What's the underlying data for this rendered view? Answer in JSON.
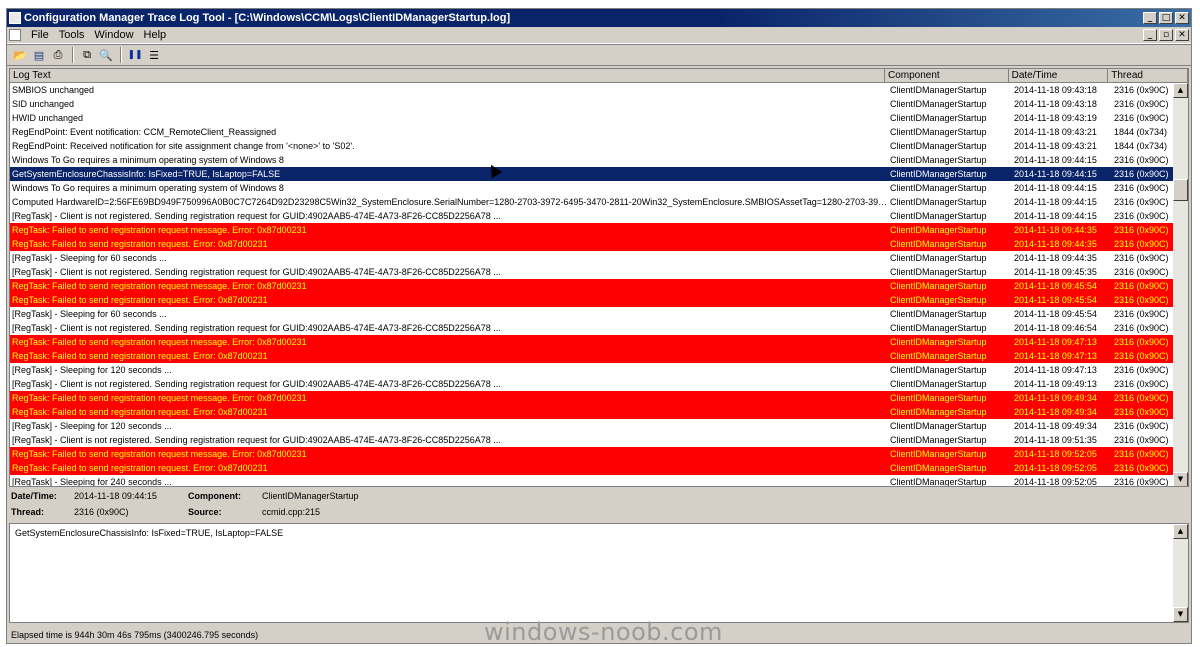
{
  "window": {
    "title": "Configuration Manager Trace Log Tool - [C:\\Windows\\CCM\\Logs\\ClientIDManagerStartup.log]",
    "minimize": "_",
    "maximize": "□",
    "close": "✕",
    "child_minimize": "_",
    "child_restore": "▫",
    "child_close": "✕"
  },
  "menu": {
    "file": "File",
    "tools": "Tools",
    "window": "Window",
    "help": "Help"
  },
  "toolbar": {
    "open": "📂",
    "save": "▤",
    "print": "⎙",
    "copy": "⧉",
    "find": "🔍",
    "pause": "❚❚",
    "view": "☰"
  },
  "columns": {
    "log_text": "Log Text",
    "component": "Component",
    "datetime": "Date/Time",
    "thread": "Thread"
  },
  "rows": [
    {
      "text": "SMBIOS unchanged",
      "component": "ClientIDManagerStartup",
      "datetime": "2014-11-18 09:43:18",
      "thread": "2316 (0x90C)",
      "type": "normal"
    },
    {
      "text": "SID unchanged",
      "component": "ClientIDManagerStartup",
      "datetime": "2014-11-18 09:43:18",
      "thread": "2316 (0x90C)",
      "type": "normal"
    },
    {
      "text": "HWID unchanged",
      "component": "ClientIDManagerStartup",
      "datetime": "2014-11-18 09:43:19",
      "thread": "2316 (0x90C)",
      "type": "normal"
    },
    {
      "text": "RegEndPoint: Event notification: CCM_RemoteClient_Reassigned",
      "component": "ClientIDManagerStartup",
      "datetime": "2014-11-18 09:43:21",
      "thread": "1844 (0x734)",
      "type": "normal"
    },
    {
      "text": "RegEndPoint: Received notification for site assignment change from '<none>' to 'S02'.",
      "component": "ClientIDManagerStartup",
      "datetime": "2014-11-18 09:43:21",
      "thread": "1844 (0x734)",
      "type": "normal"
    },
    {
      "text": "Windows To Go requires a minimum operating system of Windows 8",
      "component": "ClientIDManagerStartup",
      "datetime": "2014-11-18 09:44:15",
      "thread": "2316 (0x90C)",
      "type": "normal"
    },
    {
      "text": "GetSystemEnclosureChassisInfo: IsFixed=TRUE, IsLaptop=FALSE",
      "component": "ClientIDManagerStartup",
      "datetime": "2014-11-18 09:44:15",
      "thread": "2316 (0x90C)",
      "type": "selected"
    },
    {
      "text": "Windows To Go requires a minimum operating system of Windows 8",
      "component": "ClientIDManagerStartup",
      "datetime": "2014-11-18 09:44:15",
      "thread": "2316 (0x90C)",
      "type": "normal"
    },
    {
      "text": "Computed HardwareID=2:56FE69BD949F750996A0B0C7C7264D92D23298C5Win32_SystemEnclosure.SerialNumber=1280-2703-3972-6495-3470-2811-20Win32_SystemEnclosure.SMBIOSAssetTag=1280-2703-3972-...",
      "component": "ClientIDManagerStartup",
      "datetime": "2014-11-18 09:44:15",
      "thread": "2316 (0x90C)",
      "type": "normal"
    },
    {
      "text": "[RegTask] - Client is not registered. Sending registration request for GUID:4902AAB5-474E-4A73-8F26-CC85D2256A78 ...",
      "component": "ClientIDManagerStartup",
      "datetime": "2014-11-18 09:44:15",
      "thread": "2316 (0x90C)",
      "type": "normal"
    },
    {
      "text": "RegTask: Failed to send registration request message. Error: 0x87d00231",
      "component": "ClientIDManagerStartup",
      "datetime": "2014-11-18 09:44:35",
      "thread": "2316 (0x90C)",
      "type": "error"
    },
    {
      "text": "RegTask: Failed to send registration request. Error: 0x87d00231",
      "component": "ClientIDManagerStartup",
      "datetime": "2014-11-18 09:44:35",
      "thread": "2316 (0x90C)",
      "type": "error"
    },
    {
      "text": "[RegTask] - Sleeping for 60 seconds ...",
      "component": "ClientIDManagerStartup",
      "datetime": "2014-11-18 09:44:35",
      "thread": "2316 (0x90C)",
      "type": "normal"
    },
    {
      "text": "[RegTask] - Client is not registered. Sending registration request for GUID:4902AAB5-474E-4A73-8F26-CC85D2256A78 ...",
      "component": "ClientIDManagerStartup",
      "datetime": "2014-11-18 09:45:35",
      "thread": "2316 (0x90C)",
      "type": "normal"
    },
    {
      "text": "RegTask: Failed to send registration request message. Error: 0x87d00231",
      "component": "ClientIDManagerStartup",
      "datetime": "2014-11-18 09:45:54",
      "thread": "2316 (0x90C)",
      "type": "error"
    },
    {
      "text": "RegTask: Failed to send registration request. Error: 0x87d00231",
      "component": "ClientIDManagerStartup",
      "datetime": "2014-11-18 09:45:54",
      "thread": "2316 (0x90C)",
      "type": "error"
    },
    {
      "text": "[RegTask] - Sleeping for 60 seconds ...",
      "component": "ClientIDManagerStartup",
      "datetime": "2014-11-18 09:45:54",
      "thread": "2316 (0x90C)",
      "type": "normal"
    },
    {
      "text": "[RegTask] - Client is not registered. Sending registration request for GUID:4902AAB5-474E-4A73-8F26-CC85D2256A78 ...",
      "component": "ClientIDManagerStartup",
      "datetime": "2014-11-18 09:46:54",
      "thread": "2316 (0x90C)",
      "type": "normal"
    },
    {
      "text": "RegTask: Failed to send registration request message. Error: 0x87d00231",
      "component": "ClientIDManagerStartup",
      "datetime": "2014-11-18 09:47:13",
      "thread": "2316 (0x90C)",
      "type": "error"
    },
    {
      "text": "RegTask: Failed to send registration request. Error: 0x87d00231",
      "component": "ClientIDManagerStartup",
      "datetime": "2014-11-18 09:47:13",
      "thread": "2316 (0x90C)",
      "type": "error"
    },
    {
      "text": "[RegTask] - Sleeping for 120 seconds ...",
      "component": "ClientIDManagerStartup",
      "datetime": "2014-11-18 09:47:13",
      "thread": "2316 (0x90C)",
      "type": "normal"
    },
    {
      "text": "[RegTask] - Client is not registered. Sending registration request for GUID:4902AAB5-474E-4A73-8F26-CC85D2256A78 ...",
      "component": "ClientIDManagerStartup",
      "datetime": "2014-11-18 09:49:13",
      "thread": "2316 (0x90C)",
      "type": "normal"
    },
    {
      "text": "RegTask: Failed to send registration request message. Error: 0x87d00231",
      "component": "ClientIDManagerStartup",
      "datetime": "2014-11-18 09:49:34",
      "thread": "2316 (0x90C)",
      "type": "error"
    },
    {
      "text": "RegTask: Failed to send registration request. Error: 0x87d00231",
      "component": "ClientIDManagerStartup",
      "datetime": "2014-11-18 09:49:34",
      "thread": "2316 (0x90C)",
      "type": "error"
    },
    {
      "text": "[RegTask] - Sleeping for 120 seconds ...",
      "component": "ClientIDManagerStartup",
      "datetime": "2014-11-18 09:49:34",
      "thread": "2316 (0x90C)",
      "type": "normal"
    },
    {
      "text": "[RegTask] - Client is not registered. Sending registration request for GUID:4902AAB5-474E-4A73-8F26-CC85D2256A78 ...",
      "component": "ClientIDManagerStartup",
      "datetime": "2014-11-18 09:51:35",
      "thread": "2316 (0x90C)",
      "type": "normal"
    },
    {
      "text": "RegTask: Failed to send registration request message. Error: 0x87d00231",
      "component": "ClientIDManagerStartup",
      "datetime": "2014-11-18 09:52:05",
      "thread": "2316 (0x90C)",
      "type": "error"
    },
    {
      "text": "RegTask: Failed to send registration request. Error: 0x87d00231",
      "component": "ClientIDManagerStartup",
      "datetime": "2014-11-18 09:52:05",
      "thread": "2316 (0x90C)",
      "type": "error"
    },
    {
      "text": "[RegTask] - Sleeping for 240 seconds ...",
      "component": "ClientIDManagerStartup",
      "datetime": "2014-11-18 09:52:05",
      "thread": "2316 (0x90C)",
      "type": "normal"
    }
  ],
  "details": {
    "datetime_label": "Date/Time:",
    "datetime_value": "2014-11-18 09:44:15",
    "component_label": "Component:",
    "component_value": "ClientIDManagerStartup",
    "thread_label": "Thread:",
    "thread_value": "2316 (0x90C)",
    "source_label": "Source:",
    "source_value": "ccmid.cpp:215"
  },
  "message": "GetSystemEnclosureChassisInfo: IsFixed=TRUE, IsLaptop=FALSE",
  "status": "Elapsed time is 944h 30m 46s 795ms (3400246.795 seconds)",
  "watermark": "windows-noob.com",
  "colors": {
    "error_bg": "#ff0000",
    "error_fg": "#ffff00",
    "selected_bg": "#0a246a",
    "titlebar": "#0a246a"
  }
}
